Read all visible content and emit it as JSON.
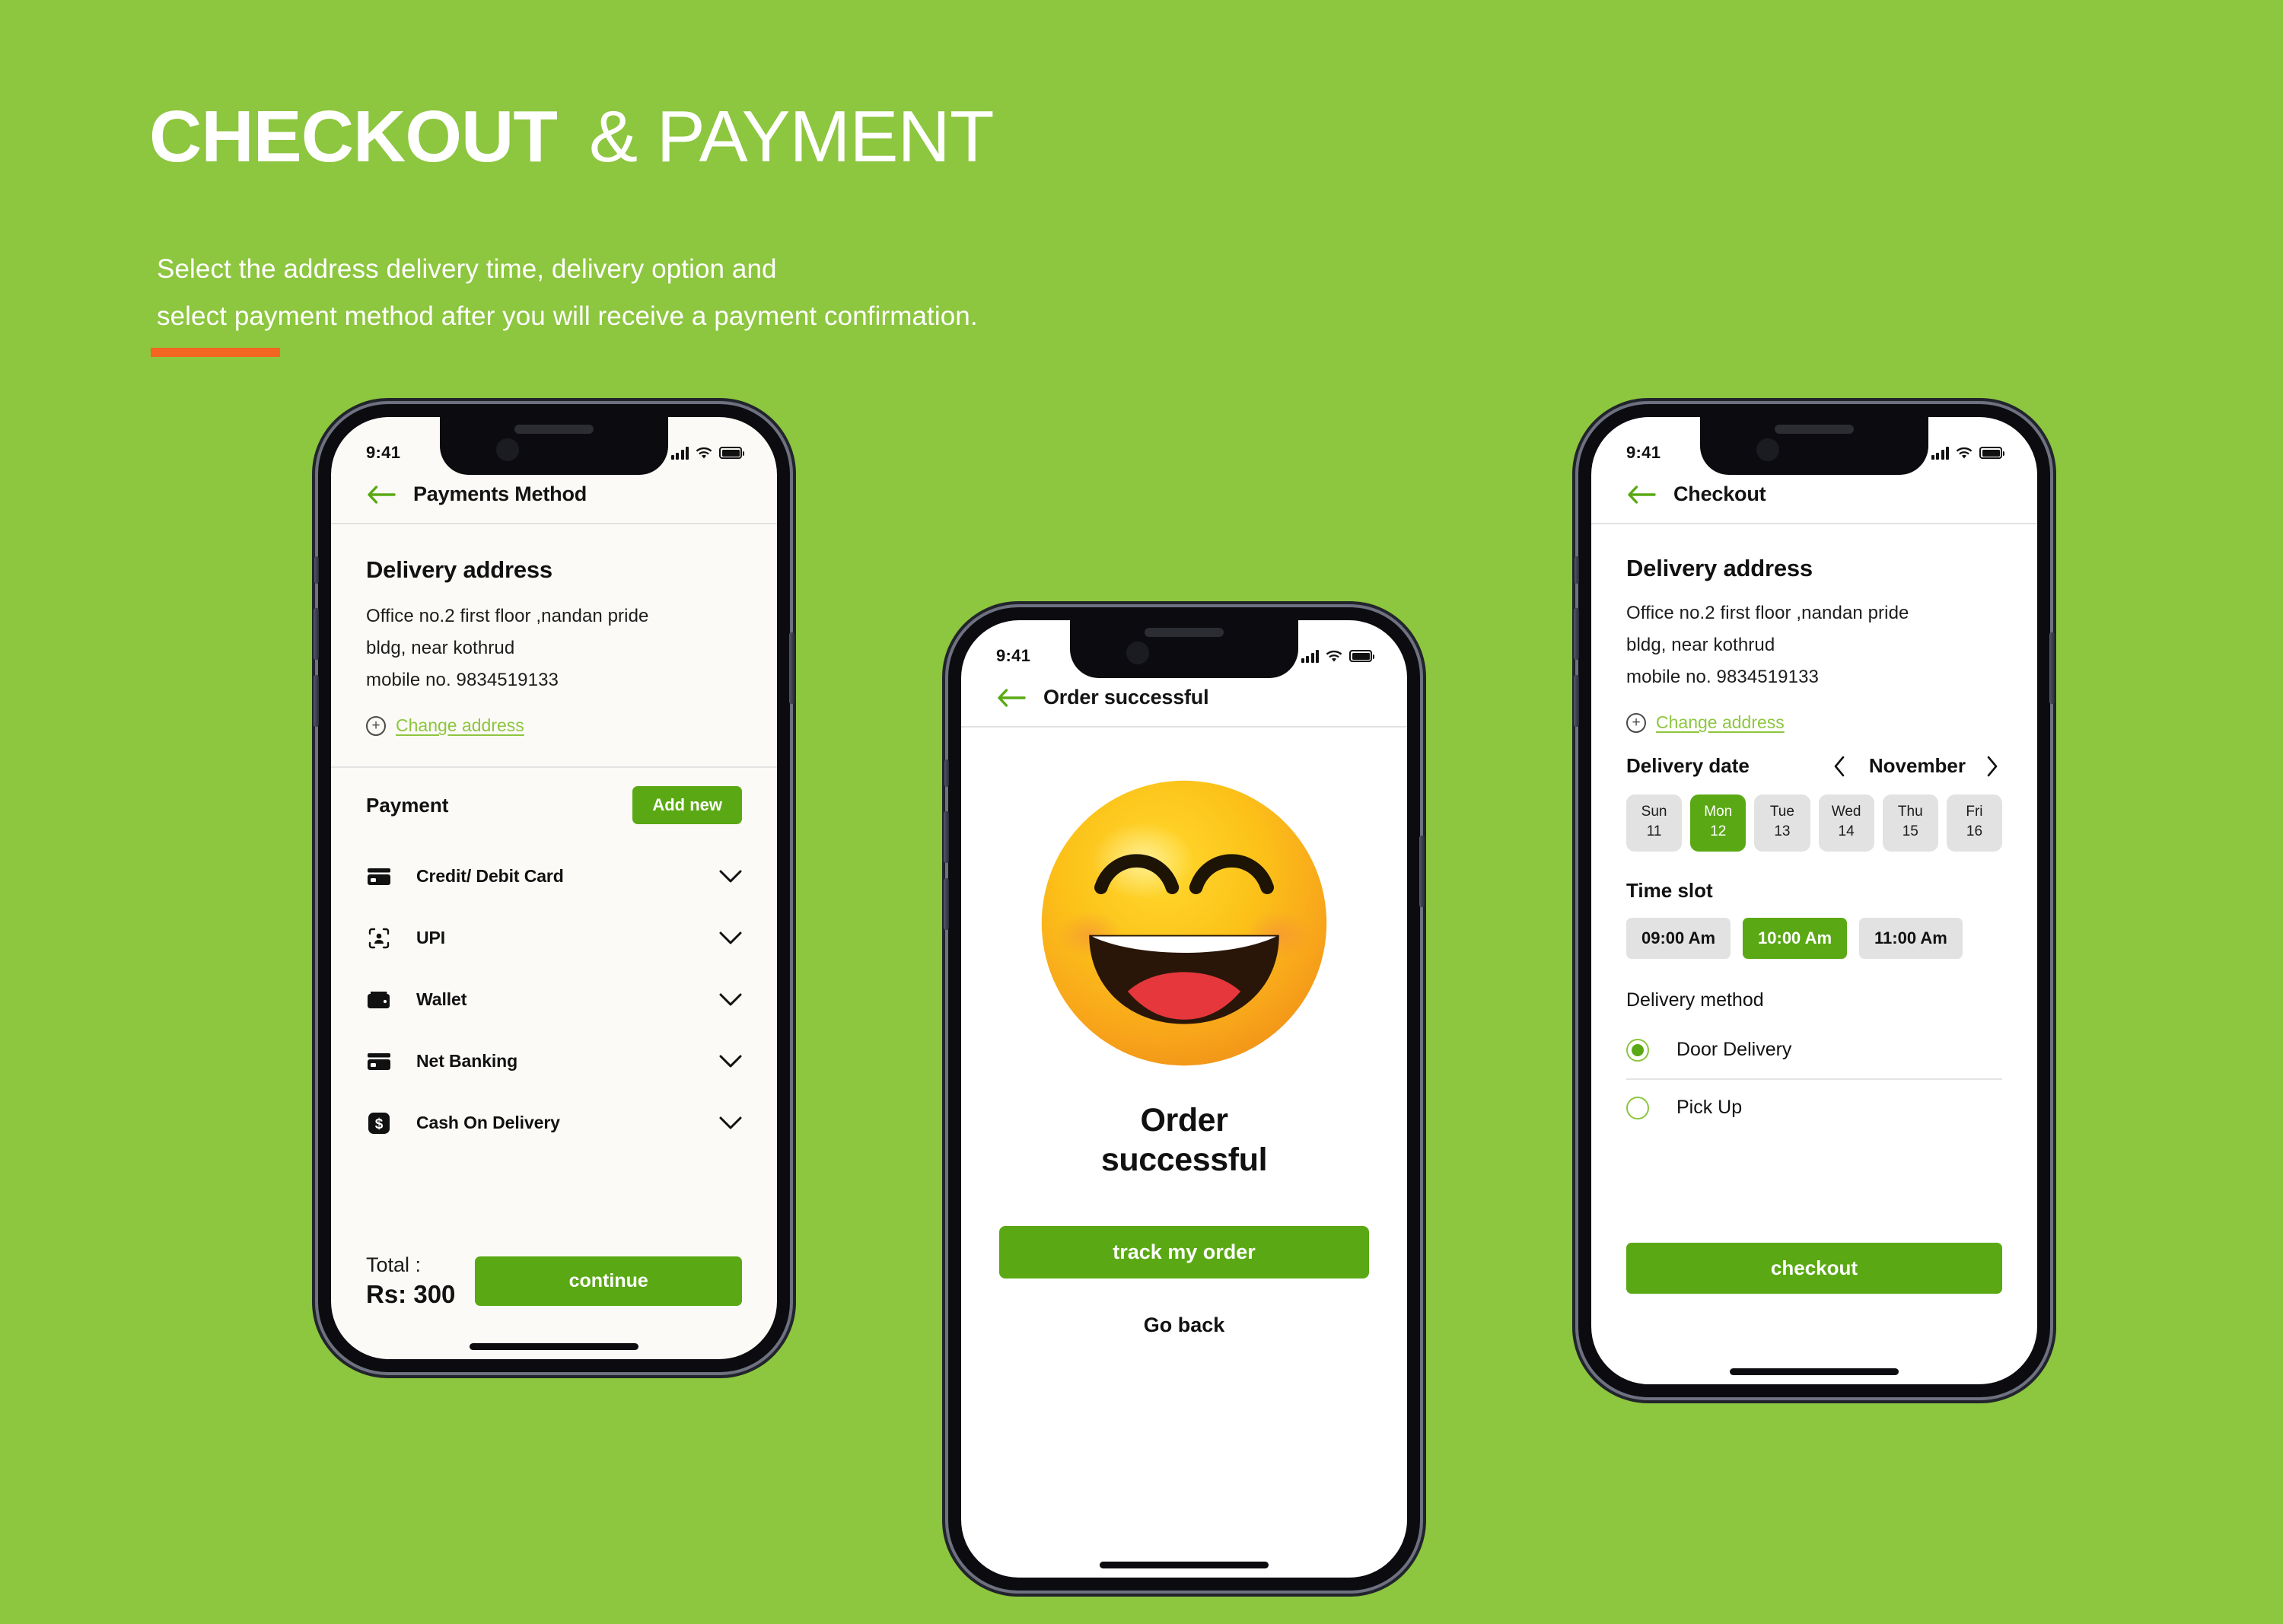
{
  "page": {
    "background_color": "#8dc63f",
    "accent_green": "#5aa914",
    "link_green": "#8dc63f",
    "accent_orange": "#f26522"
  },
  "header": {
    "title_bold": "CHECKOUT",
    "title_light": "& PAYMENT",
    "subtitle_line1": "Select the address  delivery time, delivery option and",
    "subtitle_line2": "select  payment method after you will receive a payment confirmation."
  },
  "status_bar": {
    "time": "9:41",
    "signal_icon": "cellular-signal-icon",
    "wifi_icon": "wifi-icon",
    "battery_icon": "battery-full-icon"
  },
  "phone1": {
    "nav": {
      "back_icon": "back-arrow-icon",
      "title": "Payments Method"
    },
    "address": {
      "heading": "Delivery address",
      "line1": "Office no.2 first floor ,nandan pride",
      "line2": "bldg, near kothrud",
      "line3": "mobile no. 9834519133",
      "change_label": "Change address",
      "plus_icon": "plus-circle-icon"
    },
    "payment": {
      "heading": "Payment",
      "add_new_label": "Add new",
      "methods": [
        {
          "label": "Credit/ Debit Card",
          "icon": "credit-card-icon"
        },
        {
          "label": "UPI",
          "icon": "upi-scan-person-icon"
        },
        {
          "label": "Wallet",
          "icon": "wallet-icon"
        },
        {
          "label": "Net Banking",
          "icon": "credit-card-icon"
        },
        {
          "label": "Cash On Delivery",
          "icon": "dollar-square-icon"
        }
      ],
      "chevron_icon": "chevron-down-icon"
    },
    "footer": {
      "total_label": "Total :",
      "total_value": "Rs: 300",
      "continue_label": "continue"
    }
  },
  "phone2": {
    "nav": {
      "back_icon": "back-arrow-icon",
      "title": "Order successful"
    },
    "body": {
      "emoji_icon": "smiling-face-emoji",
      "headline_line1": "Order",
      "headline_line2": "successful",
      "track_label": "track my order",
      "go_back_label": "Go back"
    }
  },
  "phone3": {
    "nav": {
      "back_icon": "back-arrow-icon",
      "title": "Checkout"
    },
    "address": {
      "heading": "Delivery address",
      "line1": "Office no.2 first floor ,nandan pride",
      "line2": "bldg, near kothrud",
      "line3": "mobile no. 9834519133",
      "change_label": "Change address",
      "plus_icon": "plus-circle-icon"
    },
    "delivery_date": {
      "heading": "Delivery date",
      "month": "November",
      "prev_icon": "chevron-left-icon",
      "next_icon": "chevron-right-icon",
      "days": [
        {
          "dow": "Sun",
          "num": "11",
          "selected": false
        },
        {
          "dow": "Mon",
          "num": "12",
          "selected": true
        },
        {
          "dow": "Tue",
          "num": "13",
          "selected": false
        },
        {
          "dow": "Wed",
          "num": "14",
          "selected": false
        },
        {
          "dow": "Thu",
          "num": "15",
          "selected": false
        },
        {
          "dow": "Fri",
          "num": "16",
          "selected": false
        }
      ]
    },
    "time_slot": {
      "heading": "Time slot",
      "slots": [
        {
          "label": "09:00 Am",
          "selected": false
        },
        {
          "label": "10:00 Am",
          "selected": true
        },
        {
          "label": "11:00 Am",
          "selected": false
        }
      ]
    },
    "delivery_method": {
      "heading": "Delivery method",
      "options": [
        {
          "label": "Door Delivery",
          "selected": true
        },
        {
          "label": "Pick Up",
          "selected": false
        }
      ]
    },
    "checkout_label": "checkout"
  }
}
